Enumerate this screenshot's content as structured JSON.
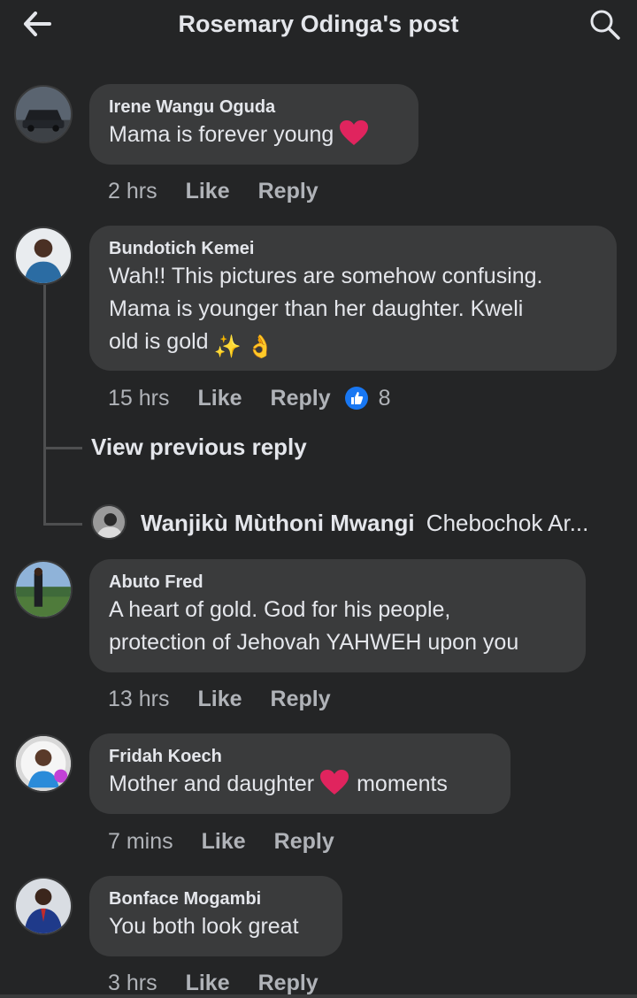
{
  "header": {
    "title": "Rosemary Odinga's post",
    "back_icon": "arrow-left-icon",
    "search_icon": "search-icon"
  },
  "comments": [
    {
      "author": "Irene Wangu Oguda",
      "text": "Mama is forever young",
      "emoji": "red-heart",
      "time": "2 hrs",
      "like": "Like",
      "reply": "Reply"
    },
    {
      "author": "Bundotich Kemei",
      "text_lines": [
        "Wah!! This pictures are somehow confusing.",
        "Mama is younger than her daughter. Kweli",
        "old is gold"
      ],
      "emojis": [
        "✨",
        "👌"
      ],
      "time": "15 hrs",
      "like": "Like",
      "reply": "Reply",
      "reaction_count": "8"
    },
    {
      "author": "Abuto Fred",
      "text_lines": [
        "A heart of gold. God for his people,",
        "protection of Jehovah YAHWEH upon you"
      ],
      "time": "13 hrs",
      "like": "Like",
      "reply": "Reply"
    },
    {
      "author": "Fridah Koech",
      "text_before": "Mother and daughter",
      "text_after": "moments",
      "emoji": "red-heart",
      "time": "7 mins",
      "like": "Like",
      "reply": "Reply"
    },
    {
      "author": "Bonface Mogambi",
      "text": "You both look great",
      "time": "3 hrs",
      "like": "Like",
      "reply": "Reply"
    }
  ],
  "thread": {
    "view_previous": "View previous reply",
    "reply_author": "Wanjikù Mùthoni Mwangi",
    "reply_preview": "Chebochok Ar..."
  },
  "colors": {
    "background": "#242526",
    "bubble": "#3a3b3c",
    "text": "#e4e6eb",
    "muted": "#b0b3b8",
    "like_blue": "#1877f2",
    "heart_red": "#e0245e"
  }
}
